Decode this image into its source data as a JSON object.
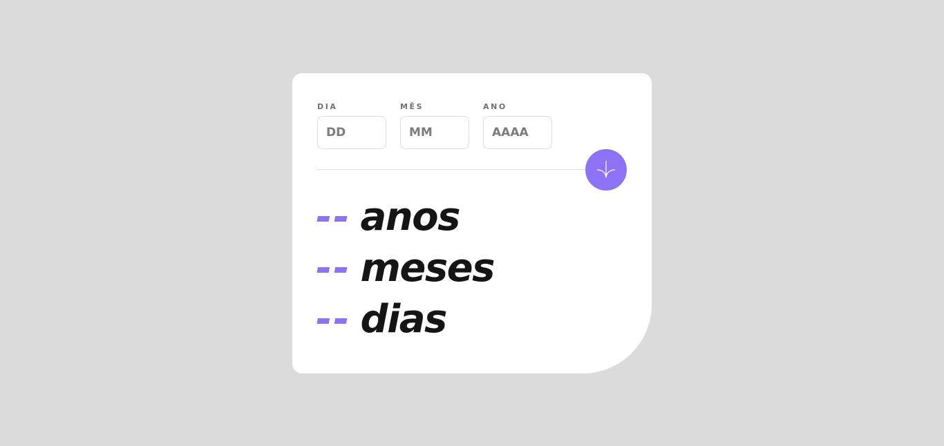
{
  "form": {
    "day": {
      "label": "DIA",
      "placeholder": "DD",
      "value": ""
    },
    "month": {
      "label": "MÊS",
      "placeholder": "MM",
      "value": ""
    },
    "year": {
      "label": "ANO",
      "placeholder": "AAAA",
      "value": ""
    }
  },
  "submit": {
    "icon": "arrow-down-icon"
  },
  "results": {
    "years": {
      "value": "--",
      "unit": "anos"
    },
    "months": {
      "value": "--",
      "unit": "meses"
    },
    "days": {
      "value": "--",
      "unit": "dias"
    }
  },
  "colors": {
    "accent": "#8e72f6",
    "background": "#dbdbdb",
    "card": "#ffffff",
    "text": "#151515",
    "label": "#716f6f"
  }
}
